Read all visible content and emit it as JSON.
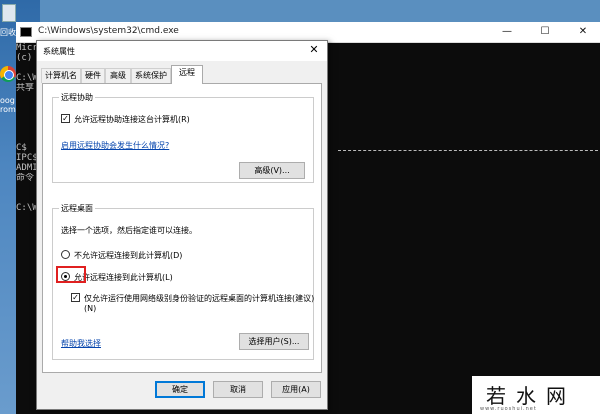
{
  "desktop": {
    "icon1_label": "回收站",
    "icon2_label_a": "oog",
    "icon2_label_b": "rom"
  },
  "cmd": {
    "title": "C:\\Windows\\system32\\cmd.exe",
    "minimize": "—",
    "maximize": "☐",
    "close": "✕",
    "lines": [
      "Micr",
      "(c)",
      "",
      "C:\\W",
      "共享",
      "",
      "",
      "",
      "",
      "",
      "C$",
      "IPC$",
      "ADMI",
      "命令",
      "",
      "",
      "C:\\W"
    ]
  },
  "dialog": {
    "title": "系统属性",
    "close": "✕",
    "tabs": [
      "计算机名",
      "硬件",
      "高级",
      "系统保护",
      "远程"
    ],
    "active_tab": "远程",
    "remote_assist": {
      "group_title": "远程协助",
      "checkbox_label": "允许远程协助连接这台计算机(R)",
      "checked": true,
      "link": "启用远程协助会发生什么情况?",
      "advanced_button": "高级(V)..."
    },
    "remote_desktop": {
      "group_title": "远程桌面",
      "instruction": "选择一个选项，然后指定谁可以连接。",
      "option_deny": "不允许远程连接到此计算机(D)",
      "option_allow": "允许远程连接到此计算机(L)",
      "selected": "allow",
      "nla_label": "仅允许运行使用网络级别身份验证的远程桌面的计算机连接(建议)",
      "nla_label_suffix": "(N)",
      "nla_checked": true,
      "help_link": "帮助我选择",
      "select_users_button": "选择用户(S)..."
    },
    "buttons": {
      "ok": "确定",
      "cancel": "取消",
      "apply": "应用(A)"
    }
  },
  "watermark": {
    "text": "若水网",
    "sub": "www.ruoshui.net"
  }
}
